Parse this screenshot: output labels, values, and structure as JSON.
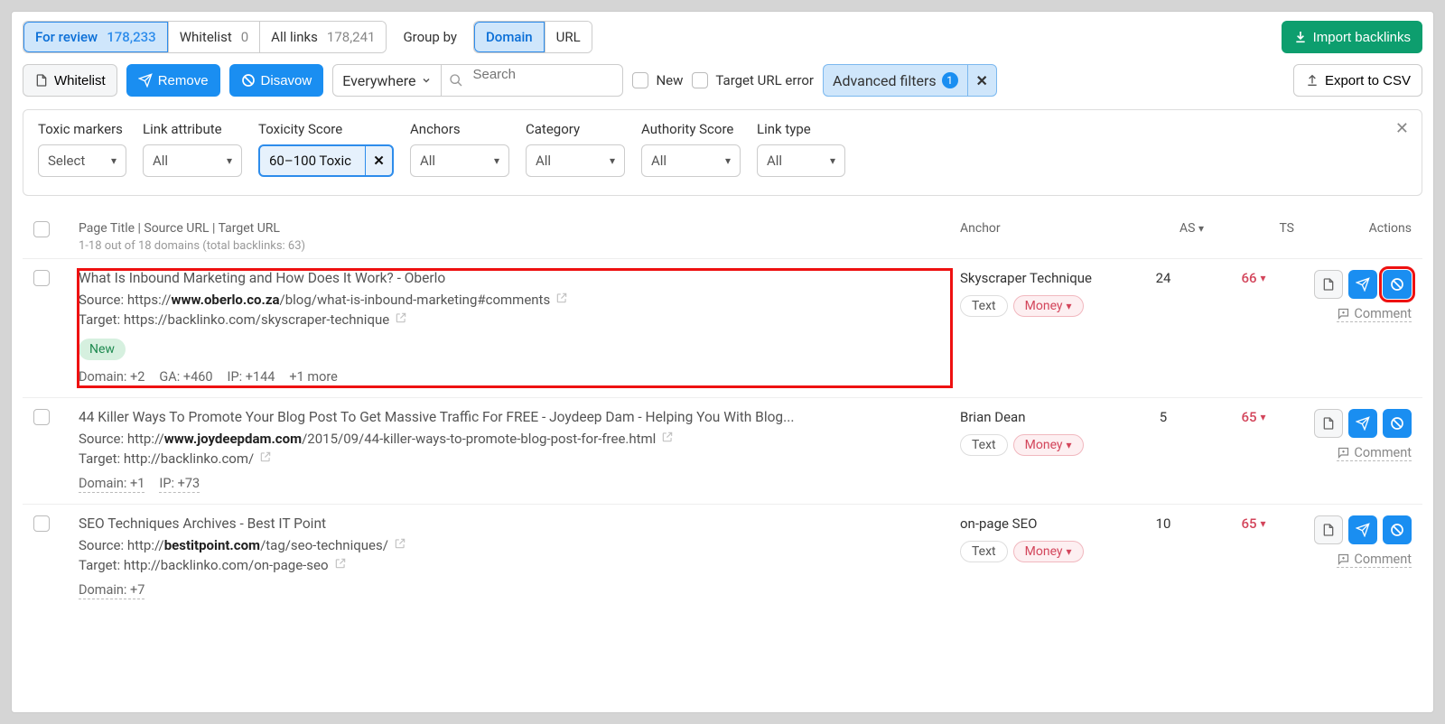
{
  "tabs": {
    "review": {
      "label": "For review",
      "count": "178,233"
    },
    "whitelist": {
      "label": "Whitelist",
      "count": "0"
    },
    "all": {
      "label": "All links",
      "count": "178,241"
    }
  },
  "groupby": {
    "label": "Group by",
    "domain": "Domain",
    "url": "URL"
  },
  "import_btn": "Import backlinks",
  "toolbar": {
    "whitelist": "Whitelist",
    "remove": "Remove",
    "disavow": "Disavow",
    "everywhere": "Everywhere",
    "search_ph": "Search",
    "new": "New",
    "target_err": "Target URL error",
    "adv": "Advanced filters",
    "adv_count": "1",
    "export": "Export to CSV"
  },
  "filters": {
    "toxic_markers": {
      "lbl": "Toxic markers",
      "val": "Select"
    },
    "link_attr": {
      "lbl": "Link attribute",
      "val": "All"
    },
    "tox_score": {
      "lbl": "Toxicity Score",
      "val": "60–100 Toxic"
    },
    "anchors": {
      "lbl": "Anchors",
      "val": "All"
    },
    "category": {
      "lbl": "Category",
      "val": "All"
    },
    "auth": {
      "lbl": "Authority Score",
      "val": "All"
    },
    "linktype": {
      "lbl": "Link type",
      "val": "All"
    }
  },
  "head": {
    "col1": "Page Title | Source URL | Target URL",
    "sub": "1-18 out of 18 domains (total backlinks: 63)",
    "anchor": "Anchor",
    "as": "AS",
    "ts": "TS",
    "actions": "Actions",
    "comment": "Comment"
  },
  "rows": [
    {
      "title": "What Is Inbound Marketing and How Does It Work? - Oberlo",
      "srcPre": "Source: https://",
      "srcBold": "www.oberlo.co.za",
      "srcPost": "/blog/what-is-inbound-marketing#comments",
      "tgtPre": "Target: https://backlinko.com/skyscraper-technique",
      "new": "New",
      "meta": [
        "Domain: +2",
        "GA: +460",
        "IP: +144",
        "+1 more"
      ],
      "anchor": "Skyscraper Technique",
      "text": "Text",
      "money": "Money",
      "as": "24",
      "ts": "66",
      "highlight": true
    },
    {
      "title": "44 Killer Ways To Promote Your Blog Post To Get Massive Traffic For FREE - Joydeep Dam - Helping You With Blog...",
      "srcPre": "Source: http://",
      "srcBold": "www.joydeepdam.com",
      "srcPost": "/2015/09/44-killer-ways-to-promote-blog-post-for-free.html",
      "tgtPre": "Target: http://backlinko.com/",
      "meta": [
        "Domain: +1",
        "IP: +73"
      ],
      "anchor": "Brian Dean",
      "text": "Text",
      "money": "Money",
      "as": "5",
      "ts": "65"
    },
    {
      "title": "SEO Techniques Archives - Best IT Point",
      "srcPre": "Source: http://",
      "srcBold": "bestitpoint.com",
      "srcPost": "/tag/seo-techniques/",
      "tgtPre": "Target: http://backlinko.com/on-page-seo",
      "meta": [
        "Domain: +7"
      ],
      "anchor": "on-page SEO",
      "text": "Text",
      "money": "Money",
      "as": "10",
      "ts": "65"
    }
  ]
}
